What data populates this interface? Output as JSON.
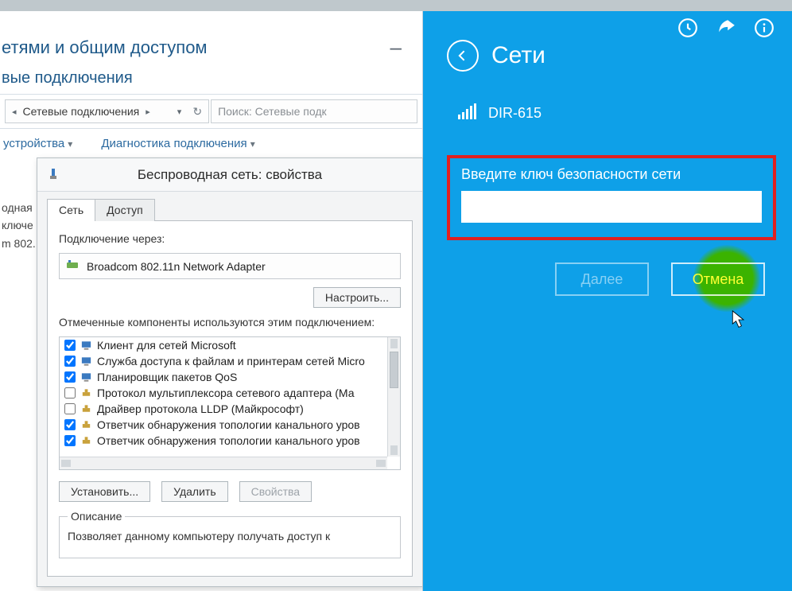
{
  "explorer": {
    "title1": "етями и общим доступом",
    "title2": "вые подключения",
    "breadcrumb": "Сетевые подключения",
    "search_placeholder": "Поиск: Сетевые подк",
    "toolbar": {
      "item1": "устройства",
      "item2": "Диагностика подключения"
    },
    "side_lines": [
      "одная",
      "ключе",
      "m 802."
    ]
  },
  "props": {
    "title": "Беспроводная сеть: свойства",
    "tabs": {
      "network": "Сеть",
      "access": "Доступ"
    },
    "connect_via": "Подключение через:",
    "adapter": "Broadcom 802.11n Network Adapter",
    "configure_btn": "Настроить...",
    "components_label": "Отмеченные компоненты используются этим подключением:",
    "components": [
      {
        "checked": true,
        "label": "Клиент для сетей Microsoft",
        "icon": "client"
      },
      {
        "checked": true,
        "label": "Служба доступа к файлам и принтерам сетей Micro",
        "icon": "service"
      },
      {
        "checked": true,
        "label": "Планировщик пакетов QoS",
        "icon": "service"
      },
      {
        "checked": false,
        "label": "Протокол мультиплексора сетевого адаптера (Ма",
        "icon": "protocol"
      },
      {
        "checked": false,
        "label": "Драйвер протокола LLDP (Майкрософт)",
        "icon": "protocol"
      },
      {
        "checked": true,
        "label": "Ответчик обнаружения топологии канального уров",
        "icon": "protocol"
      },
      {
        "checked": true,
        "label": "Ответчик обнаружения топологии канального уров",
        "icon": "protocol"
      }
    ],
    "install_btn": "Установить...",
    "remove_btn": "Удалить",
    "props_btn": "Свойства",
    "desc_legend": "Описание",
    "desc_text": "Позволяет данному компьютеру получать доступ к"
  },
  "charm": {
    "title": "Сети",
    "network_name": "DIR-615",
    "key_prompt": "Введите ключ безопасности сети",
    "next_btn": "Далее",
    "cancel_btn": "Отмена"
  }
}
